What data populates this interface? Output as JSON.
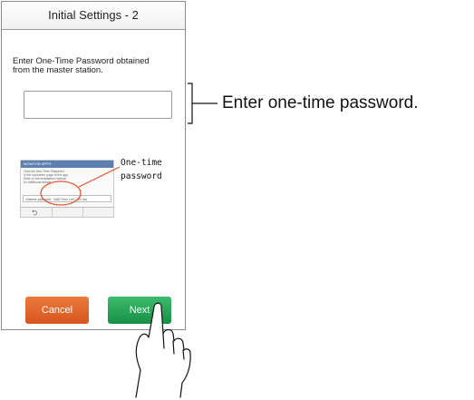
{
  "screen": {
    "title": "Initial Settings - 2",
    "instruction": "Enter One-Time Password obtained\nfrom the master station.",
    "password_field_value": "",
    "cancel_label": "Cancel",
    "next_label": "Next"
  },
  "help_thumbnail": {
    "header": "MONITOR APPS",
    "body": "Click the Non-Time Password\nin the top/center page of the app.\nRefer to the installation manual\nfor additional details.",
    "row_text": "Onetime password : 0660   Time   Left   /  300 sec"
  },
  "annotations": {
    "field_callout": "Enter one-time password.",
    "otp_callout": "One-time\npassword"
  },
  "colors": {
    "cancel": "#d85620",
    "next": "#169046",
    "highlight_circle": "#e05a32"
  }
}
